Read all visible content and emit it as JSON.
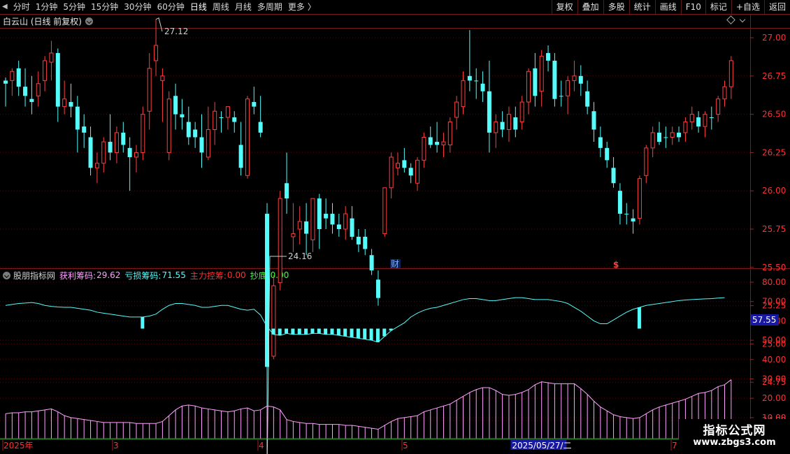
{
  "toolbar": {
    "periods": [
      "分时",
      "1分钟",
      "5分钟",
      "15分钟",
      "30分钟",
      "60分钟",
      "日线",
      "周线",
      "月线",
      "多周期",
      "更多"
    ],
    "more_suffix": "〉",
    "buttons": [
      "复权",
      "叠加",
      "多股",
      "统计",
      "画线",
      "F10",
      "标记",
      "+自选",
      "返回"
    ]
  },
  "stock": {
    "title": "白云山 (日线 前复权)"
  },
  "price_axis": [
    "27.00",
    "26.75",
    "26.50",
    "26.25",
    "26.00",
    "25.75",
    "25.50",
    "25.25",
    "25.00",
    "24.75",
    "24.50"
  ],
  "price_annotations": {
    "high": "27.12",
    "low": "24.16"
  },
  "event_markers": {
    "finance": "财",
    "dollar": "$"
  },
  "indicator": {
    "name": "股朋指标网",
    "profit_label": "获利筹码:",
    "profit_value": "29.62",
    "loss_label": "亏损筹码:",
    "loss_value": "71.55",
    "control_label": "主力控筹:",
    "control_value": "0.00",
    "bottom_label": "抄底:",
    "bottom_value": "0.00",
    "axis": [
      "80.00",
      "70.00",
      "60.00",
      "50.00",
      "40.00",
      "30.00",
      "20.00",
      "10.00"
    ],
    "cursor_value": "57.55"
  },
  "date_axis": {
    "labels": [
      "2025年",
      "3",
      "4",
      "5",
      "7"
    ],
    "cursor_date": "2025/05/27/二"
  },
  "watermark": {
    "line1": "指标公式网",
    "line2": "www.zbgs3.com"
  },
  "colors": {
    "up": "#ff4040",
    "down": "#54fcfc",
    "profit_line": "#ffa0ff",
    "loss_line": "#54fcfc",
    "ma": "#ffffff",
    "control": "#ff3030",
    "bottom": "#40ff40"
  },
  "chart_data": {
    "type": "candlestick",
    "candles": [
      [
        26.72,
        26.74,
        26.55,
        26.7
      ],
      [
        26.72,
        26.8,
        26.62,
        26.78
      ],
      [
        26.8,
        26.85,
        26.62,
        26.68
      ],
      [
        26.68,
        26.8,
        26.55,
        26.62
      ],
      [
        26.6,
        26.75,
        26.5,
        26.58
      ],
      [
        26.62,
        26.78,
        26.55,
        26.7
      ],
      [
        26.72,
        26.88,
        26.65,
        26.85
      ],
      [
        26.84,
        26.98,
        26.72,
        26.9
      ],
      [
        26.9,
        26.93,
        26.45,
        26.55
      ],
      [
        26.55,
        26.72,
        26.5,
        26.6
      ],
      [
        26.58,
        26.7,
        26.48,
        26.55
      ],
      [
        26.55,
        26.62,
        26.25,
        26.4
      ],
      [
        26.42,
        26.5,
        26.28,
        26.38
      ],
      [
        26.35,
        26.42,
        26.1,
        26.15
      ],
      [
        26.15,
        26.25,
        26.05,
        26.18
      ],
      [
        26.18,
        26.35,
        26.12,
        26.32
      ],
      [
        26.32,
        26.5,
        26.2,
        26.25
      ],
      [
        26.25,
        26.42,
        26.18,
        26.38
      ],
      [
        26.38,
        26.45,
        26.25,
        26.3
      ],
      [
        26.28,
        26.35,
        26.0,
        26.22
      ],
      [
        26.22,
        26.3,
        26.12,
        26.25
      ],
      [
        26.25,
        26.55,
        26.2,
        26.5
      ],
      [
        26.52,
        26.9,
        26.4,
        26.8
      ],
      [
        26.85,
        27.12,
        26.75,
        26.95
      ],
      [
        26.72,
        26.8,
        26.45,
        26.75
      ],
      [
        26.25,
        26.65,
        26.2,
        26.6
      ],
      [
        26.62,
        26.7,
        26.4,
        26.5
      ],
      [
        26.5,
        26.6,
        26.4,
        26.48
      ],
      [
        26.45,
        26.55,
        26.3,
        26.35
      ],
      [
        26.4,
        26.45,
        26.28,
        26.35
      ],
      [
        26.35,
        26.5,
        26.15,
        26.25
      ],
      [
        26.22,
        26.55,
        26.2,
        26.4
      ],
      [
        26.4,
        26.58,
        26.3,
        26.52
      ],
      [
        26.48,
        26.52,
        26.38,
        26.48
      ],
      [
        26.48,
        26.55,
        26.4,
        26.55
      ],
      [
        26.48,
        26.52,
        26.38,
        26.45
      ],
      [
        26.3,
        26.45,
        26.1,
        26.15
      ],
      [
        26.1,
        26.62,
        26.08,
        26.6
      ],
      [
        26.58,
        26.68,
        26.5,
        26.55
      ],
      [
        26.45,
        26.62,
        26.35,
        26.38
      ],
      [
        25.85,
        25.92,
        24.16,
        24.85
      ],
      [
        24.92,
        25.45,
        24.9,
        25.38
      ],
      [
        25.4,
        26.0,
        25.35,
        25.95
      ],
      [
        26.05,
        26.25,
        25.85,
        25.95
      ],
      [
        25.7,
        25.92,
        25.6,
        25.72
      ],
      [
        25.75,
        25.9,
        25.65,
        25.8
      ],
      [
        25.8,
        25.92,
        25.58,
        25.72
      ],
      [
        25.68,
        25.95,
        25.6,
        25.95
      ],
      [
        25.95,
        25.98,
        25.62,
        25.75
      ],
      [
        25.85,
        25.95,
        25.75,
        25.82
      ],
      [
        25.85,
        25.92,
        25.72,
        25.78
      ],
      [
        25.78,
        25.85,
        25.7,
        25.75
      ],
      [
        25.75,
        25.9,
        25.68,
        25.85
      ],
      [
        25.82,
        25.9,
        25.68,
        25.7
      ],
      [
        25.7,
        25.75,
        25.6,
        25.65
      ],
      [
        25.7,
        25.75,
        25.58,
        25.62
      ],
      [
        25.58,
        25.62,
        25.45,
        25.48
      ],
      [
        25.42,
        25.48,
        25.25,
        25.3
      ],
      [
        25.72,
        26.0,
        25.7,
        26.02
      ],
      [
        26.02,
        26.25,
        25.95,
        26.22
      ],
      [
        26.15,
        26.25,
        26.1,
        26.18
      ],
      [
        26.2,
        26.28,
        26.12,
        26.15
      ],
      [
        26.15,
        26.18,
        26.05,
        26.1
      ],
      [
        26.05,
        26.22,
        26.0,
        26.2
      ],
      [
        26.2,
        26.38,
        26.15,
        26.35
      ],
      [
        26.35,
        26.42,
        26.28,
        26.3
      ],
      [
        26.32,
        26.45,
        26.25,
        26.3
      ],
      [
        26.3,
        26.38,
        26.22,
        26.32
      ],
      [
        26.3,
        26.48,
        26.25,
        26.45
      ],
      [
        26.48,
        26.62,
        26.4,
        26.58
      ],
      [
        26.55,
        26.78,
        26.5,
        26.72
      ],
      [
        26.75,
        27.05,
        26.65,
        26.72
      ],
      [
        26.72,
        26.8,
        26.6,
        26.72
      ],
      [
        26.7,
        26.78,
        26.58,
        26.65
      ],
      [
        26.65,
        26.85,
        26.25,
        26.38
      ],
      [
        26.38,
        26.5,
        26.28,
        26.45
      ],
      [
        26.45,
        26.52,
        26.35,
        26.4
      ],
      [
        26.4,
        26.55,
        26.32,
        26.5
      ],
      [
        26.48,
        26.55,
        26.35,
        26.4
      ],
      [
        26.45,
        26.62,
        26.4,
        26.58
      ],
      [
        26.58,
        26.8,
        26.5,
        26.78
      ],
      [
        26.8,
        26.9,
        26.55,
        26.62
      ],
      [
        26.65,
        26.92,
        26.55,
        26.88
      ],
      [
        26.9,
        26.95,
        26.78,
        26.85
      ],
      [
        26.85,
        26.9,
        26.55,
        26.6
      ],
      [
        26.62,
        26.72,
        26.55,
        26.62
      ],
      [
        26.62,
        26.75,
        26.5,
        26.72
      ],
      [
        26.72,
        26.85,
        26.65,
        26.75
      ],
      [
        26.75,
        26.82,
        26.62,
        26.7
      ],
      [
        26.65,
        26.72,
        26.5,
        26.55
      ],
      [
        26.52,
        26.58,
        26.32,
        26.4
      ],
      [
        26.35,
        26.42,
        26.22,
        26.28
      ],
      [
        26.28,
        26.32,
        26.15,
        26.2
      ],
      [
        26.15,
        26.22,
        26.02,
        26.05
      ],
      [
        26.0,
        26.05,
        25.78,
        25.85
      ],
      [
        25.85,
        25.92,
        25.78,
        25.85
      ],
      [
        25.82,
        25.88,
        25.72,
        25.8
      ],
      [
        25.82,
        26.1,
        25.78,
        26.08
      ],
      [
        26.1,
        26.3,
        26.05,
        26.28
      ],
      [
        26.28,
        26.42,
        26.22,
        26.38
      ],
      [
        26.38,
        26.45,
        26.3,
        26.32
      ],
      [
        26.35,
        26.42,
        26.28,
        26.35
      ],
      [
        26.35,
        26.42,
        26.3,
        26.38
      ],
      [
        26.38,
        26.42,
        26.32,
        26.35
      ],
      [
        26.38,
        26.48,
        26.32,
        26.45
      ],
      [
        26.45,
        26.55,
        26.4,
        26.5
      ],
      [
        26.48,
        26.52,
        26.38,
        26.42
      ],
      [
        26.42,
        26.52,
        26.35,
        26.5
      ],
      [
        26.48,
        26.55,
        26.4,
        26.48
      ],
      [
        26.5,
        26.62,
        26.45,
        26.6
      ],
      [
        26.6,
        26.72,
        26.55,
        26.68
      ],
      [
        26.68,
        26.88,
        26.6,
        26.85
      ]
    ],
    "loss_chips": [
      68,
      68.5,
      69,
      69.2,
      69.5,
      69,
      68,
      67.5,
      67.2,
      67,
      67,
      66.5,
      66,
      65.5,
      64.5,
      64,
      63.5,
      63,
      62.5,
      62,
      62,
      62,
      62.5,
      63.5,
      66,
      68,
      69,
      69,
      68.5,
      68,
      67,
      67,
      67.5,
      68,
      68,
      67,
      66,
      65.5,
      66,
      63,
      57,
      53,
      52.5,
      53.5,
      53,
      53,
      53,
      53.5,
      53.5,
      53,
      53,
      52.5,
      52,
      51.5,
      51,
      50.5,
      50,
      49,
      52,
      55,
      57,
      59,
      62,
      64,
      65.5,
      66.5,
      67,
      68,
      69,
      70,
      71,
      71.5,
      71.5,
      71,
      70.5,
      70.5,
      71,
      71.5,
      72,
      72,
      71.5,
      71,
      71,
      71,
      70.5,
      70,
      69,
      67,
      65,
      62.5,
      60,
      58.5,
      58.5,
      60.5,
      62.5,
      64.5,
      66,
      67,
      68,
      68.5,
      69,
      69.5,
      70,
      70.5,
      70.8,
      71,
      71.2,
      71.4,
      71.5,
      71.8,
      72
    ],
    "profit_chips": [
      12,
      12.5,
      12.5,
      13,
      13,
      13.5,
      14,
      14.5,
      13,
      11,
      10,
      9.5,
      9,
      8.5,
      8,
      7.5,
      7.5,
      7.5,
      7.5,
      7.5,
      7,
      7,
      7,
      7,
      8,
      11,
      14,
      16,
      16.5,
      16,
      15,
      14.5,
      14,
      13.5,
      13,
      13.5,
      14.5,
      15,
      13.5,
      14,
      16,
      15.5,
      14,
      9,
      8,
      7.5,
      7,
      7,
      6.5,
      6.5,
      6.5,
      6.5,
      6,
      6,
      5.5,
      5,
      4.5,
      4,
      6,
      8,
      9.5,
      10,
      10.5,
      11,
      13,
      14,
      15,
      16,
      17,
      19,
      21,
      23,
      24.5,
      25.5,
      25.5,
      24,
      22,
      21.5,
      22,
      23,
      24.5,
      27,
      28.5,
      28,
      27.5,
      27.5,
      27.5,
      27.5,
      25,
      22,
      18.5,
      15.5,
      13.5,
      11.5,
      10.5,
      10,
      9.5,
      10,
      12,
      14,
      15.5,
      16.5,
      17.5,
      18.5,
      19.5,
      21,
      22.5,
      23,
      24,
      26,
      27,
      29.62
    ],
    "cursor_index": 84,
    "price_range": [
      24.16,
      27.12
    ],
    "indicator_range": [
      0,
      80
    ]
  }
}
